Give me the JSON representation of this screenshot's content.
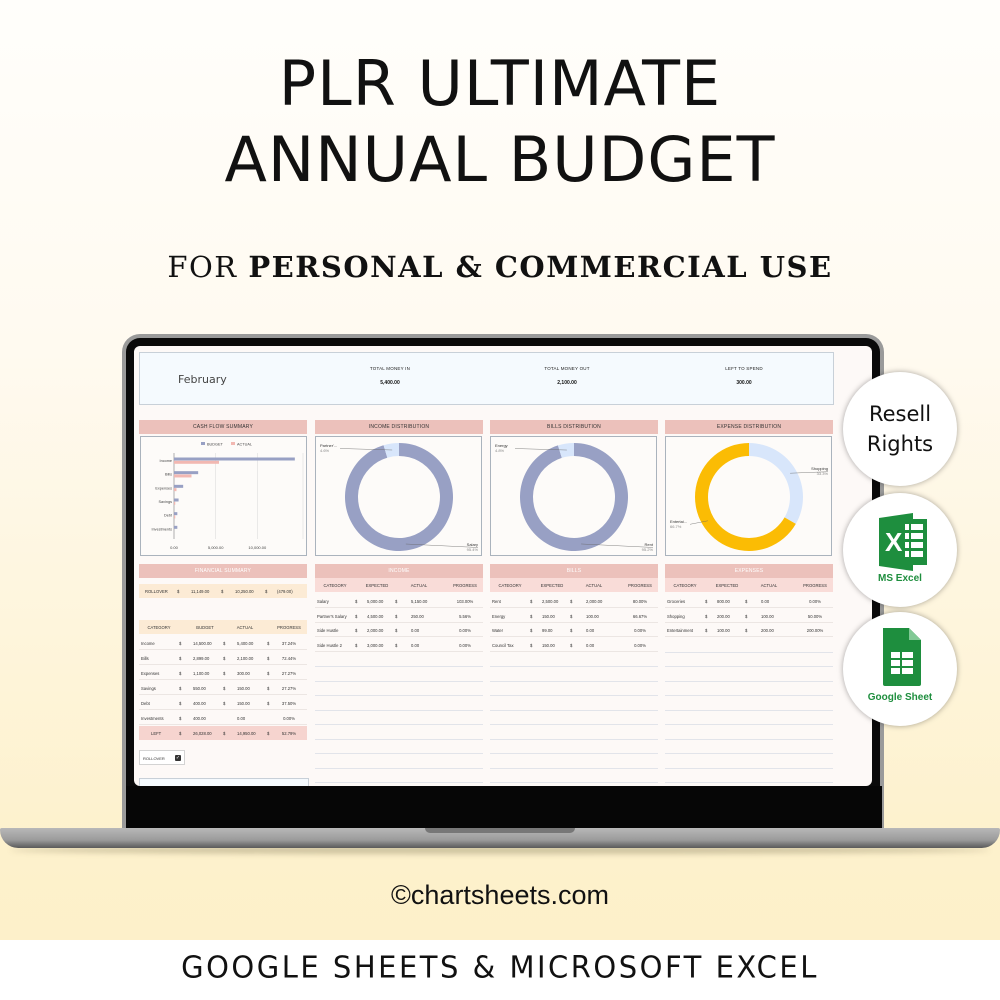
{
  "hero": {
    "title_line1": "PLR ULTIMATE",
    "title_line2": "ANNUAL BUDGET",
    "subtitle_prefix": "FOR",
    "subtitle_bold": "PERSONAL & COMMERCIAL USE"
  },
  "dashboard": {
    "month": "February",
    "kpis": [
      {
        "label": "TOTAL MONEY IN",
        "value": "5,400.00"
      },
      {
        "label": "TOTAL MONEY OUT",
        "value": "2,100.00"
      },
      {
        "label": "LEFT TO SPEND",
        "value": "300.00"
      }
    ],
    "panels": {
      "cashflow": "CASH FLOW SUMMARY",
      "income_dist": "INCOME DISTRIBUTION",
      "bills_dist": "BILLS DISTRIBUTION",
      "expense_dist": "EXPENSE DISTRIBUTION",
      "financial_summary": "FINANCIAL SUMMARY",
      "income": "INCOME",
      "bills": "BILLS",
      "expenses": "EXPENSES"
    },
    "financial_summary": {
      "rollover": {
        "label": "ROLLOVER",
        "c1": "$",
        "v1": "11,149.00",
        "c2": "$",
        "v2": "10,250.00",
        "c3": "$",
        "v3": "(479.00)"
      },
      "headers": [
        "CATEGORY",
        "BUDGET",
        "ACTUAL",
        "PROGRESS"
      ],
      "rows": [
        {
          "category": "Income",
          "cur1": "$",
          "budget": "14,500.00",
          "cur2": "$",
          "actual": "5,400.00",
          "cur3": "$",
          "progress": "37.24%"
        },
        {
          "category": "Bills",
          "cur1": "$",
          "budget": "2,899.00",
          "cur2": "$",
          "actual": "2,100.00",
          "cur3": "$",
          "progress": "72.44%"
        },
        {
          "category": "Expenses",
          "cur1": "$",
          "budget": "1,100.00",
          "cur2": "$",
          "actual": "300.00",
          "cur3": "$",
          "progress": "27.27%"
        },
        {
          "category": "Savings",
          "cur1": "$",
          "budget": "550.00",
          "cur2": "$",
          "actual": "150.00",
          "cur3": "$",
          "progress": "27.27%"
        },
        {
          "category": "Debt",
          "cur1": "$",
          "budget": "400.00",
          "cur2": "$",
          "actual": "150.00",
          "cur3": "$",
          "progress": "37.50%"
        },
        {
          "category": "Investments",
          "cur1": "$",
          "budget": "400.00",
          "cur2": "",
          "actual": "0.00",
          "cur3": "",
          "progress": "0.00%"
        }
      ],
      "left_row": {
        "category": "LEFT",
        "cur1": "$",
        "budget": "26,028.00",
        "cur2": "$",
        "actual": "14,950.00",
        "cur3": "$",
        "progress": "52.79%"
      },
      "rollover_checkbox": {
        "label": "ROLLOVER",
        "checked": true,
        "check_glyph": "✓"
      }
    },
    "income_table": {
      "headers": [
        "CATEGORY",
        "EXPECTED",
        "ACTUAL",
        "PROGRESS"
      ],
      "rows": [
        {
          "category": "Salary",
          "cur1": "$",
          "expected": "5,000.00",
          "cur2": "$",
          "actual": "5,150.00",
          "progress": "103.00%"
        },
        {
          "category": "Partner's Salary",
          "cur1": "$",
          "expected": "4,500.00",
          "cur2": "$",
          "actual": "250.00",
          "progress": "5.56%"
        },
        {
          "category": "Side Hustle",
          "cur1": "$",
          "expected": "2,000.00",
          "cur2": "$",
          "actual": "0.00",
          "progress": "0.00%"
        },
        {
          "category": "Side Hustle 2",
          "cur1": "$",
          "expected": "3,000.00",
          "cur2": "$",
          "actual": "0.00",
          "progress": "0.00%"
        }
      ]
    },
    "bills_table": {
      "headers": [
        "CATEGORY",
        "EXPECTED",
        "ACTUAL",
        "PROGRESS"
      ],
      "rows": [
        {
          "category": "Rent",
          "cur1": "$",
          "expected": "2,500.00",
          "cur2": "$",
          "actual": "2,000.00",
          "progress": "80.00%"
        },
        {
          "category": "Energy",
          "cur1": "$",
          "expected": "150.00",
          "cur2": "$",
          "actual": "100.00",
          "progress": "66.67%"
        },
        {
          "category": "Water",
          "cur1": "$",
          "expected": "99.00",
          "cur2": "$",
          "actual": "0.00",
          "progress": "0.00%"
        },
        {
          "category": "Council Tax",
          "cur1": "$",
          "expected": "150.00",
          "cur2": "$",
          "actual": "0.00",
          "progress": "0.00%"
        }
      ]
    },
    "expenses_table": {
      "headers": [
        "CATEGORY",
        "EXPECTED",
        "ACTUAL",
        "PROGRESS"
      ],
      "rows": [
        {
          "category": "Groceries",
          "cur1": "$",
          "expected": "800.00",
          "cur2": "$",
          "actual": "0.00",
          "progress": "0.00%"
        },
        {
          "category": "Shopping",
          "cur1": "$",
          "expected": "200.00",
          "cur2": "$",
          "actual": "100.00",
          "progress": "50.00%"
        },
        {
          "category": "Entertainment",
          "cur1": "$",
          "expected": "100.00",
          "cur2": "$",
          "actual": "200.00",
          "progress": "200.00%"
        }
      ]
    }
  },
  "chart_data": [
    {
      "type": "bar",
      "orientation": "horizontal",
      "title": "CASH FLOW SUMMARY",
      "categories": [
        "Income",
        "Bills",
        "Expenses",
        "Savings",
        "Debt",
        "Investments"
      ],
      "series": [
        {
          "name": "BUDGET",
          "color": "#98a0c4",
          "values": [
            14500,
            2899,
            1100,
            550,
            400,
            400
          ]
        },
        {
          "name": "ACTUAL",
          "color": "#f2b8b2",
          "values": [
            5400,
            2100,
            300,
            150,
            150,
            0
          ]
        }
      ],
      "xlim": [
        0,
        15000
      ],
      "xticks": [
        "0.00",
        "5,000.00",
        "10,000.00"
      ],
      "xtick_values": [
        0,
        5000,
        10000
      ],
      "legend": "top",
      "grid": true
    },
    {
      "type": "pie",
      "donut": true,
      "title": "INCOME DISTRIBUTION",
      "slices": [
        {
          "label": "Salary",
          "pct_label": "95.4%",
          "value": 95.4,
          "color": "#98a0c4"
        },
        {
          "label": "Partner'...",
          "pct_label": "4.6%",
          "value": 4.6,
          "color": "#d8e6fb"
        }
      ]
    },
    {
      "type": "pie",
      "donut": true,
      "title": "BILLS DISTRIBUTION",
      "slices": [
        {
          "label": "Rent",
          "pct_label": "95.2%",
          "value": 95.2,
          "color": "#98a0c4"
        },
        {
          "label": "Energy",
          "pct_label": "4.8%",
          "value": 4.8,
          "color": "#d8e6fb"
        }
      ]
    },
    {
      "type": "pie",
      "donut": true,
      "title": "EXPENSE DISTRIBUTION",
      "slices": [
        {
          "label": "Shopping",
          "pct_label": "33.3%",
          "value": 33.3,
          "color": "#d8e6fb"
        },
        {
          "label": "Entertai...",
          "pct_label": "66.7%",
          "value": 66.7,
          "color": "#fbbc04"
        }
      ]
    }
  ],
  "badges": {
    "resell_line1": "Resell",
    "resell_line2": "Rights",
    "excel_label": "MS Excel",
    "excel_color": "#1e8e3e",
    "gsheet_label": "Google Sheet",
    "gsheet_color": "#1e8e3e"
  },
  "footer": {
    "copyright_symbol": "©",
    "site": "chartsheets.com",
    "platforms": "GOOGLE SHEETS & MICROSOFT EXCEL"
  }
}
